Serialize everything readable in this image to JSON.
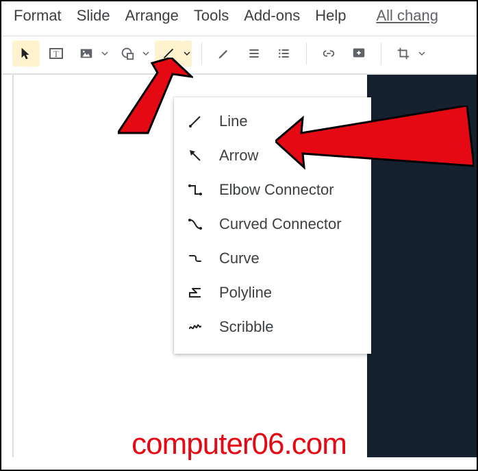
{
  "menubar": {
    "items": [
      "Format",
      "Slide",
      "Arrange",
      "Tools",
      "Add-ons",
      "Help"
    ],
    "all_changes": "All chang"
  },
  "toolbar": {
    "select": "Select",
    "textbox": "Text box",
    "image": "Insert image",
    "shape": "Shape",
    "line": "Line",
    "pen": "Paint format",
    "align": "Align",
    "list": "List",
    "link": "Insert link",
    "comment": "Add comment",
    "crop": "Crop image"
  },
  "line_menu": {
    "items": [
      {
        "label": "Line",
        "icon": "line"
      },
      {
        "label": "Arrow",
        "icon": "arrow"
      },
      {
        "label": "Elbow Connector",
        "icon": "elbow"
      },
      {
        "label": "Curved Connector",
        "icon": "curved"
      },
      {
        "label": "Curve",
        "icon": "curve"
      },
      {
        "label": "Polyline",
        "icon": "polyline"
      },
      {
        "label": "Scribble",
        "icon": "scribble"
      }
    ]
  },
  "watermark": "computer06.com",
  "annotation": {
    "color": "#e50914"
  }
}
